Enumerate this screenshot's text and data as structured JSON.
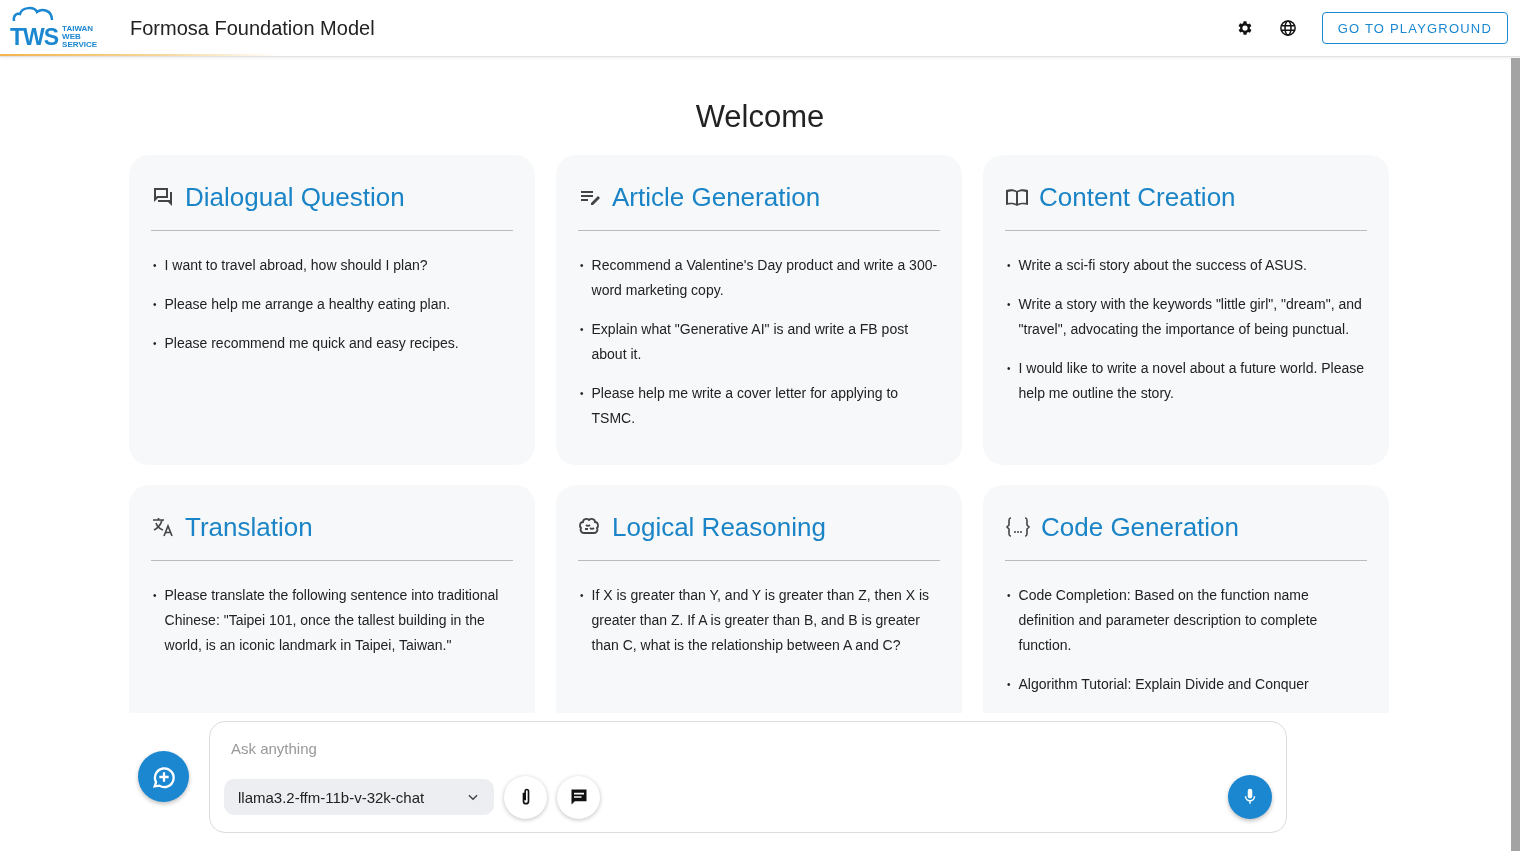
{
  "header": {
    "logo_text": "TWS",
    "logo_subtext": [
      "TAIWAN",
      "WEB",
      "SERVICE"
    ],
    "title": "Formosa Foundation Model",
    "playground_button": "GO TO PLAYGROUND"
  },
  "welcome": "Welcome",
  "bullet": "•",
  "cards": [
    {
      "kind": "dialog",
      "title": "Dialogual Question",
      "items": [
        "I want to travel abroad, how should I plan?",
        "Please help me arrange a healthy eating plan.",
        "Please recommend me quick and easy recipes."
      ]
    },
    {
      "kind": "article",
      "title": "Article Generation",
      "items": [
        "Recommend a Valentine's Day product and write a 300-word marketing copy.",
        "Explain what \"Generative AI\" is and write a FB post about it.",
        "Please help me write a cover letter for applying to TSMC."
      ]
    },
    {
      "kind": "book",
      "title": "Content Creation",
      "items": [
        "Write a sci-fi story about the success of ASUS.",
        "Write a story with the keywords \"little girl\", \"dream\", and \"travel\", advocating the importance of being punctual.",
        "I would like to write a novel about a future world. Please help me outline the story."
      ]
    },
    {
      "kind": "translate",
      "title": "Translation",
      "items": [
        "Please translate the following sentence into traditional Chinese: \"Taipei 101, once the tallest building in the world, is an iconic landmark in Taipei, Taiwan.\""
      ]
    },
    {
      "kind": "brain",
      "title": "Logical Reasoning",
      "items": [
        "If X is greater than Y, and Y is greater than Z, then X is greater than Z. If A is greater than B, and B is greater than C, what is the relationship between A and C?"
      ]
    },
    {
      "kind": "code",
      "title": "Code Generation",
      "items": [
        "Code Completion: Based on the function name definition and parameter description to complete function.",
        "Algorithm Tutorial: Explain Divide and Conquer"
      ]
    }
  ],
  "chat": {
    "placeholder": "Ask anything",
    "model": "llama3.2-ffm-11b-v-32k-chat"
  }
}
